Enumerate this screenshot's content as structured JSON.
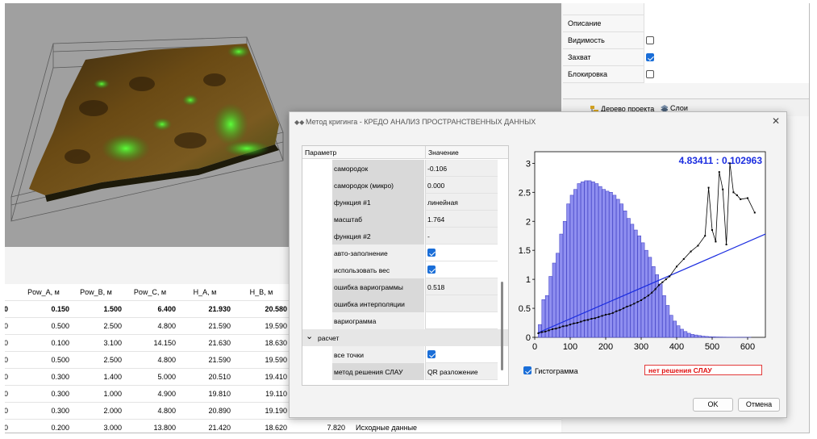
{
  "properties": [
    {
      "label": "",
      "type": "text"
    },
    {
      "label": "Описание",
      "type": "text"
    },
    {
      "label": "Видимость",
      "type": "checkbox",
      "checked": false
    },
    {
      "label": "Захват",
      "type": "checkbox",
      "checked": true
    },
    {
      "label": "Блокировка",
      "type": "checkbox",
      "checked": false
    }
  ],
  "panel_tabs": {
    "project_tree": "Дерево проекта",
    "layers": "Слои"
  },
  "table": {
    "headers": [
      "Pow_A, м",
      "Pow_B, м",
      "Pow_C, м",
      "H_A, м",
      "H_B, м"
    ],
    "rows": [
      [
        "0.150",
        "1.500",
        "6.400",
        "21.930",
        "20.580"
      ],
      [
        "0.500",
        "2.500",
        "4.800",
        "21.590",
        "19.590"
      ],
      [
        "0.100",
        "3.100",
        "14.150",
        "21.630",
        "18.630"
      ],
      [
        "0.500",
        "2.500",
        "4.800",
        "21.590",
        "19.590"
      ],
      [
        "0.300",
        "1.400",
        "5.000",
        "20.510",
        "19.410"
      ],
      [
        "0.300",
        "1.000",
        "4.900",
        "19.810",
        "19.110"
      ],
      [
        "0.300",
        "2.000",
        "4.800",
        "20.890",
        "19.190"
      ],
      [
        "0.200",
        "3.000",
        "13.800",
        "21.420",
        "18.620"
      ]
    ],
    "row_prefix": "0",
    "last_row_extra": {
      "value": "7.820",
      "label": "Исходные данные"
    }
  },
  "dialog": {
    "title": "Метод кригинга - КРЕДО АНАЛИЗ ПРОСТРАНСТВЕННЫХ ДАННЫХ",
    "param_header": "Параметр",
    "value_header": "Значение",
    "params": [
      {
        "name": "самородок",
        "value": "-0.106",
        "type": "text"
      },
      {
        "name": "самородок (микро)",
        "value": "0.000",
        "type": "text"
      },
      {
        "name": "функция #1",
        "value": "линейная",
        "type": "text"
      },
      {
        "name": "масштаб",
        "value": "1.764",
        "type": "text"
      },
      {
        "name": "функция #2",
        "value": "-",
        "type": "text"
      },
      {
        "name": "авто-заполнение",
        "value": "",
        "type": "checkbox",
        "checked": true
      },
      {
        "name": "использовать вес",
        "value": "",
        "type": "checkbox",
        "checked": true
      },
      {
        "name": "ошибка вариограммы",
        "value": "0.518",
        "type": "text"
      },
      {
        "name": "ошибка интерполяции",
        "value": "",
        "type": "text"
      },
      {
        "name": "вариограмма",
        "value": "",
        "type": "text"
      }
    ],
    "group_label": "расчет",
    "group_params": [
      {
        "name": "все точки",
        "value": "",
        "type": "checkbox",
        "checked": true
      },
      {
        "name": "метод решения СЛАУ",
        "value": "QR разложение",
        "type": "text"
      }
    ],
    "histogram_label": "Гистограмма",
    "histogram_checked": true,
    "no_solution": "нет решения СЛАУ",
    "ok": "OK",
    "cancel": "Отмена"
  },
  "chart_data": {
    "type": "bar",
    "annotation": "4.83411 : 0.102963",
    "xlim": [
      0,
      650
    ],
    "ylim": [
      0,
      3.2
    ],
    "x_ticks": [
      0,
      100,
      200,
      300,
      400,
      500,
      600
    ],
    "y_ticks": [
      0,
      0.5,
      1,
      1.5,
      2,
      2.5,
      3
    ],
    "histogram": {
      "bin_width": 10,
      "bin_starts": [
        10,
        20,
        30,
        40,
        50,
        60,
        70,
        80,
        90,
        100,
        110,
        120,
        130,
        140,
        150,
        160,
        170,
        180,
        190,
        200,
        210,
        220,
        230,
        240,
        250,
        260,
        270,
        280,
        290,
        300,
        310,
        320,
        330,
        340,
        350,
        360,
        370,
        380,
        390,
        400,
        410,
        420,
        430,
        440,
        450,
        460,
        470,
        480,
        490,
        500,
        510,
        520,
        530,
        540,
        550,
        560,
        570,
        580,
        590,
        600
      ],
      "values": [
        0.22,
        0.65,
        0.72,
        1.05,
        1.28,
        1.45,
        1.78,
        2.0,
        2.3,
        2.45,
        2.55,
        2.65,
        2.68,
        2.7,
        2.7,
        2.68,
        2.65,
        2.6,
        2.55,
        2.52,
        2.5,
        2.45,
        2.38,
        2.3,
        2.18,
        2.05,
        1.95,
        1.85,
        1.75,
        1.63,
        1.5,
        1.38,
        1.22,
        1.08,
        0.92,
        0.72,
        0.55,
        0.38,
        0.28,
        0.2,
        0.14,
        0.1,
        0.07,
        0.05,
        0.04,
        0.03,
        0.02,
        0.015,
        0.01,
        0.008,
        0.006,
        0.005,
        0.004,
        0.003,
        0.002,
        0.002,
        0.001,
        0.001,
        0.001,
        0.001
      ]
    },
    "series": [
      {
        "type": "line",
        "style": "black-points",
        "x": [
          10,
          20,
          30,
          40,
          50,
          60,
          70,
          80,
          90,
          100,
          110,
          120,
          130,
          140,
          150,
          160,
          170,
          180,
          190,
          200,
          210,
          220,
          230,
          240,
          250,
          260,
          270,
          280,
          290,
          300,
          310,
          320,
          330,
          340,
          350,
          360,
          370,
          380,
          400,
          420,
          440,
          460,
          480,
          490,
          500,
          510,
          520,
          530,
          540,
          550,
          560,
          570,
          580,
          600,
          620
        ],
        "y": [
          0.07,
          0.09,
          0.1,
          0.12,
          0.14,
          0.15,
          0.17,
          0.19,
          0.2,
          0.22,
          0.24,
          0.25,
          0.27,
          0.29,
          0.3,
          0.32,
          0.33,
          0.35,
          0.37,
          0.39,
          0.4,
          0.42,
          0.45,
          0.47,
          0.5,
          0.53,
          0.55,
          0.58,
          0.61,
          0.64,
          0.68,
          0.72,
          0.77,
          0.83,
          0.9,
          0.95,
          1.0,
          1.05,
          1.22,
          1.35,
          1.48,
          1.58,
          1.75,
          2.58,
          1.85,
          1.65,
          2.85,
          2.55,
          1.6,
          3.0,
          2.5,
          2.45,
          2.38,
          2.4,
          2.15
        ]
      },
      {
        "type": "line",
        "style": "blue-fit",
        "x": [
          10,
          650
        ],
        "y": [
          0.08,
          1.78
        ]
      }
    ]
  }
}
